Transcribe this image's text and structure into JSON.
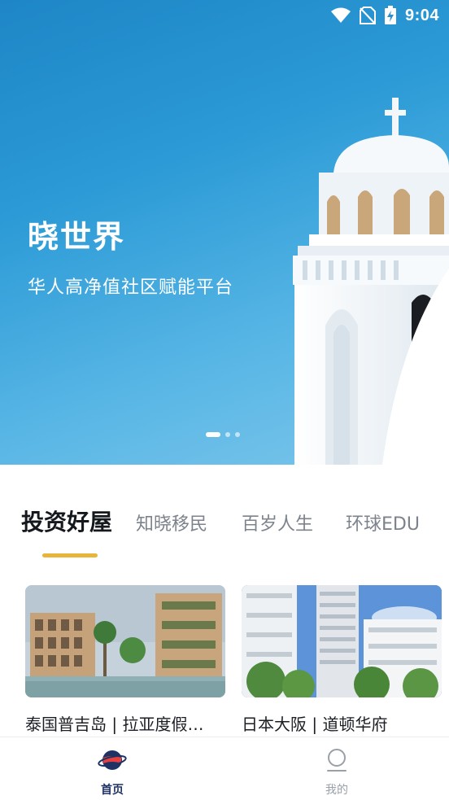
{
  "status_bar": {
    "time": "9:04",
    "icons": [
      "wifi-icon",
      "no-sim-icon",
      "battery-charging-icon"
    ]
  },
  "hero": {
    "title": "晓世界",
    "subtitle": "华人高净值社区赋能平台",
    "carousel_pages": 3,
    "active_page": 1
  },
  "tabs": [
    {
      "label": "投资好屋",
      "active": true
    },
    {
      "label": "知晓移民",
      "active": false
    },
    {
      "label": "百岁人生",
      "active": false
    },
    {
      "label": "环球EDU",
      "active": false
    }
  ],
  "cards": [
    {
      "title": "泰国普吉岛 | 拉亚度假…"
    },
    {
      "title": "日本大阪 | 道顿华府"
    }
  ],
  "bottom_nav": [
    {
      "label": "首页",
      "icon": "planet-icon",
      "active": true
    },
    {
      "label": "我的",
      "icon": "profile-icon",
      "active": false
    }
  ],
  "colors": {
    "tab_indicator": "#e8b53a",
    "nav_active": "#1f3264",
    "nav_inactive": "#9aa0a8"
  }
}
